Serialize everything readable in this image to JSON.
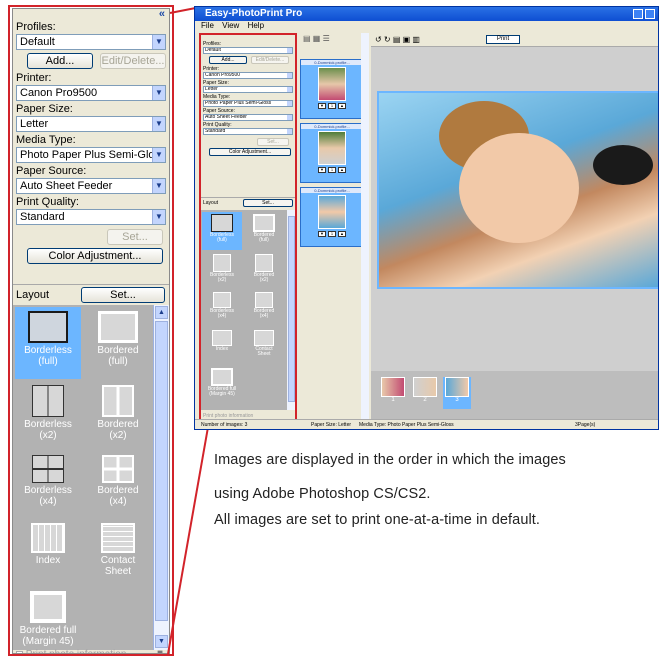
{
  "zoom_panel": {
    "collapse_glyph": "«",
    "profiles_label": "Profiles:",
    "profiles_value": "Default",
    "add_button": "Add...",
    "edit_delete_button": "Edit/Delete...",
    "printer_label": "Printer:",
    "printer_value": "Canon Pro9500",
    "paper_size_label": "Paper Size:",
    "paper_size_value": "Letter",
    "media_type_label": "Media Type:",
    "media_type_value": "Photo Paper Plus Semi-Gloss",
    "paper_source_label": "Paper Source:",
    "paper_source_value": "Auto Sheet Feeder",
    "print_quality_label": "Print Quality:",
    "print_quality_value": "Standard",
    "set_quality_button": "Set...",
    "color_adjustment_button": "Color Adjustment...",
    "layout_label": "Layout",
    "layout_set_button": "Set...",
    "layouts": [
      {
        "l1": "Borderless",
        "l2": "(full)"
      },
      {
        "l1": "Bordered",
        "l2": "(full)"
      },
      {
        "l1": "Borderless",
        "l2": "(x2)"
      },
      {
        "l1": "Bordered",
        "l2": "(x2)"
      },
      {
        "l1": "Borderless",
        "l2": "(x4)"
      },
      {
        "l1": "Bordered",
        "l2": "(x4)"
      },
      {
        "l1": "Index",
        "l2": ""
      },
      {
        "l1": "Contact",
        "l2": "Sheet"
      },
      {
        "l1": "Bordered full",
        "l2": "(Margin 45)"
      }
    ],
    "print_photo_info": "Print photo information"
  },
  "window": {
    "title": "Easy-PhotoPrint Pro",
    "menu": [
      "File",
      "View",
      "Help"
    ],
    "print_button": "Print",
    "strip_items": [
      "0-Dommick.profile...",
      "0-Dommick.profile...",
      "0-Dommick.profile..."
    ],
    "copies": [
      "1",
      "1",
      "1"
    ],
    "bottom_thumb_numbers": [
      "1",
      "2",
      "3"
    ],
    "status": {
      "images": "Number of images: 3",
      "paper": "Paper Size: Letter",
      "media": "Media Type: Photo Paper Plus Semi-Gloss",
      "pages": "3Page(s)"
    }
  },
  "text": {
    "line1": "Images are displayed in the order in which the images",
    "line2": "using Adobe Photoshop CS/CS2.",
    "line3": "All images are set to print one-at-a-time in default."
  },
  "colors": {
    "highlight_red": "#d2232a",
    "selection_blue": "#6cb6ff",
    "panel_bg": "#ece9d8",
    "thumb_bg": "#b2b2b2"
  }
}
